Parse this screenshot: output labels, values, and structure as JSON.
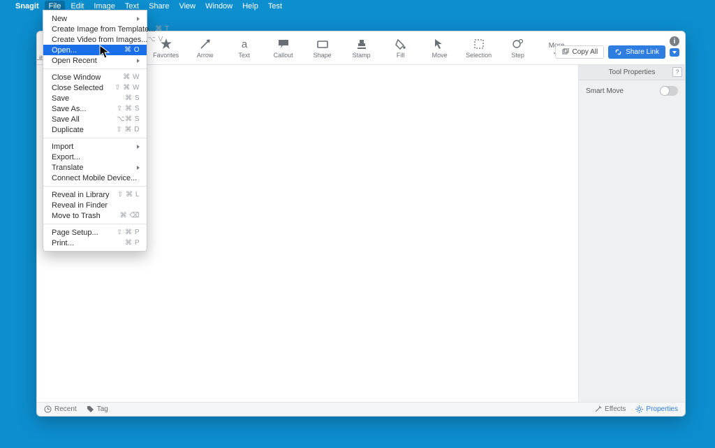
{
  "menubar": {
    "app": "Snagit",
    "items": [
      "File",
      "Edit",
      "Image",
      "Text",
      "Share",
      "View",
      "Window",
      "Help",
      "Test"
    ],
    "active": "File"
  },
  "file_menu": {
    "groups": [
      [
        {
          "label": "New",
          "shortcut": "",
          "submenu": true
        },
        {
          "label": "Create Image from Template...",
          "shortcut": "⌘ T"
        },
        {
          "label": "Create Video from Images...",
          "shortcut": "⌥ V"
        },
        {
          "label": "Open...",
          "shortcut": "⌘ O",
          "highlight": true
        },
        {
          "label": "Open Recent",
          "shortcut": "",
          "submenu": true
        }
      ],
      [
        {
          "label": "Close Window",
          "shortcut": "⌘ W"
        },
        {
          "label": "Close Selected",
          "shortcut": "⇧ ⌘ W"
        },
        {
          "label": "Save",
          "shortcut": "⌘ S"
        },
        {
          "label": "Save As...",
          "shortcut": "⇧ ⌘ S"
        },
        {
          "label": "Save All",
          "shortcut": "⌥⌘ S"
        },
        {
          "label": "Duplicate",
          "shortcut": "⇧ ⌘ D"
        }
      ],
      [
        {
          "label": "Import",
          "shortcut": "",
          "submenu": true
        },
        {
          "label": "Export...",
          "shortcut": ""
        },
        {
          "label": "Translate",
          "shortcut": "",
          "submenu": true
        },
        {
          "label": "Connect Mobile Device...",
          "shortcut": ""
        }
      ],
      [
        {
          "label": "Reveal in Library",
          "shortcut": "⇧ ⌘ L"
        },
        {
          "label": "Reveal in Finder",
          "shortcut": ""
        },
        {
          "label": "Move to Trash",
          "shortcut": "⌘ ⌫"
        }
      ],
      [
        {
          "label": "Page Setup...",
          "shortcut": "⇧ ⌘ P"
        },
        {
          "label": "Print...",
          "shortcut": "⌘ P"
        }
      ]
    ]
  },
  "toolbar": {
    "tools": [
      {
        "name": "favorites",
        "label": "Favorites",
        "icon": "★"
      },
      {
        "name": "arrow",
        "label": "Arrow",
        "icon": "↖"
      },
      {
        "name": "text",
        "label": "Text",
        "icon": "a"
      },
      {
        "name": "callout",
        "label": "Callout",
        "icon": "💬"
      },
      {
        "name": "shape",
        "label": "Shape",
        "icon": "▭"
      },
      {
        "name": "stamp",
        "label": "Stamp",
        "icon": "⍟"
      },
      {
        "name": "fill",
        "label": "Fill",
        "icon": "◍"
      },
      {
        "name": "move",
        "label": "Move",
        "icon": "↔"
      },
      {
        "name": "selection",
        "label": "Selection",
        "icon": "▦"
      },
      {
        "name": "step",
        "label": "Step",
        "icon": "①"
      }
    ],
    "more": "More",
    "copy_all": "Copy All",
    "share_link": "Share Link"
  },
  "leftmargin": {
    "label": "Lib"
  },
  "sidepanel": {
    "title": "Tool Properties",
    "smart_move": "Smart Move"
  },
  "status": {
    "recent": "Recent",
    "tag": "Tag",
    "effects": "Effects",
    "properties": "Properties"
  }
}
